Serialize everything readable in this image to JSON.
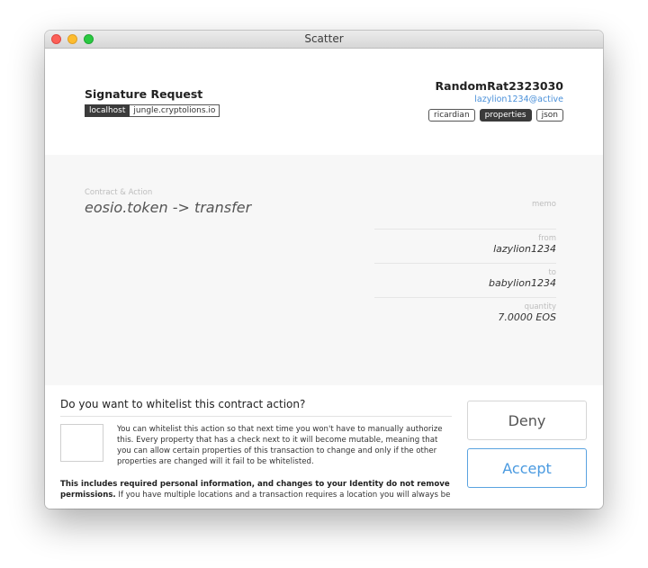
{
  "window": {
    "title": "Scatter"
  },
  "header": {
    "title": "Signature Request",
    "origin_tag": "localhost",
    "origin_host": "jungle.cryptolions.io",
    "account_name": "RandomRat2323030",
    "account_permission": "lazylion1234@active",
    "tabs": [
      {
        "label": "ricardian",
        "active": false
      },
      {
        "label": "properties",
        "active": true
      },
      {
        "label": "json",
        "active": false
      }
    ]
  },
  "action": {
    "label": "Contract & Action",
    "value": "eosio.token -> transfer",
    "properties": [
      {
        "label": "memo",
        "value": ""
      },
      {
        "label": "from",
        "value": "lazylion1234"
      },
      {
        "label": "to",
        "value": "babylion1234"
      },
      {
        "label": "quantity",
        "value": "7.0000 EOS"
      }
    ]
  },
  "whitelist": {
    "question": "Do you want to whitelist this contract action?",
    "description": "You can whitelist this action so that next time you won't have to manually authorize this. Every property that has a check next to it will become mutable, meaning that you can allow certain properties of this transaction to change and only if the other properties are changed will it fail to be whitelisted.",
    "warning_bold": "This includes required personal information, and changes to your Identity do not remove permissions.",
    "warning_rest": " If you have multiple locations and a transaction requires a location you will always be"
  },
  "buttons": {
    "deny": "Deny",
    "accept": "Accept"
  },
  "colors": {
    "accent": "#4a9ae0",
    "dark_tag": "#3b3b3b",
    "detail_bg": "#f7f7f7"
  }
}
